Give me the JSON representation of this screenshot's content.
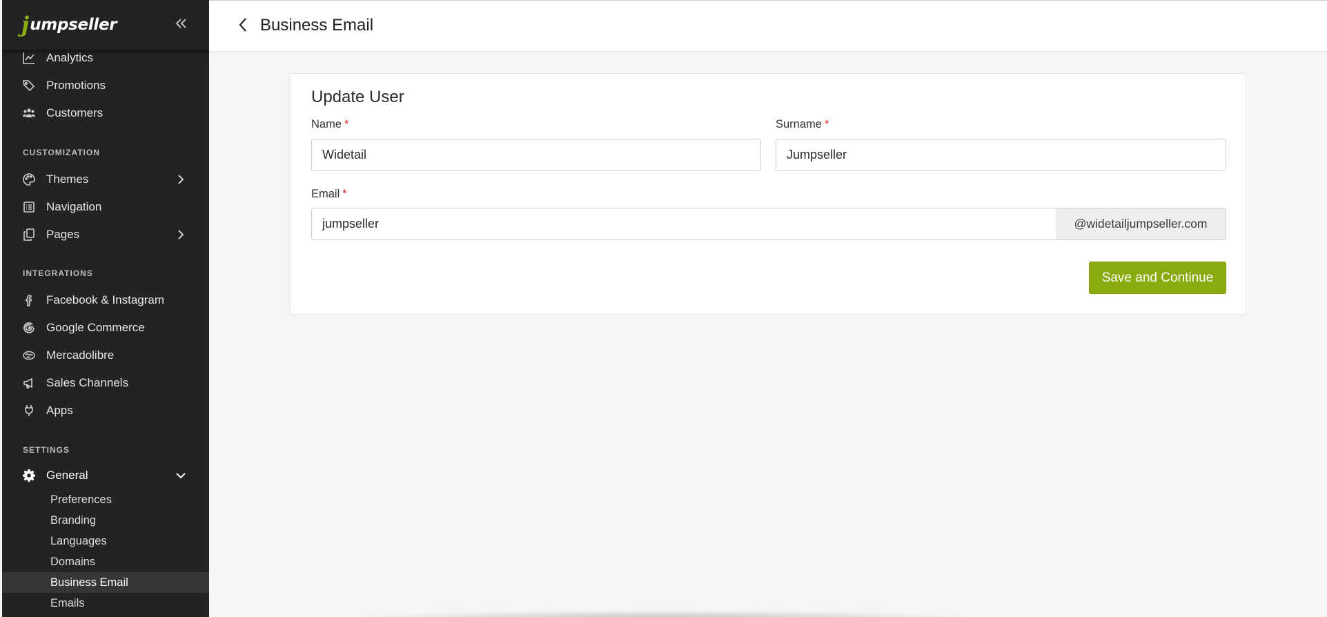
{
  "app": {
    "brand_j": "j",
    "brand_rest": "umpseller"
  },
  "sidebar": {
    "top_items": [
      {
        "label": "Analytics",
        "icon": "chart-line-icon"
      },
      {
        "label": "Promotions",
        "icon": "tags-icon"
      },
      {
        "label": "Customers",
        "icon": "users-icon"
      }
    ],
    "sections": {
      "customization": "CUSTOMIZATION",
      "integrations": "INTEGRATIONS",
      "settings": "SETTINGS"
    },
    "customization_items": [
      {
        "label": "Themes",
        "icon": "palette-icon",
        "has_submenu": true
      },
      {
        "label": "Navigation",
        "icon": "list-icon",
        "has_submenu": false
      },
      {
        "label": "Pages",
        "icon": "pages-icon",
        "has_submenu": true
      }
    ],
    "integration_items": [
      {
        "label": "Facebook & Instagram",
        "icon": "facebook-icon"
      },
      {
        "label": "Google Commerce",
        "icon": "google-icon"
      },
      {
        "label": "Mercadolibre",
        "icon": "handshake-icon"
      },
      {
        "label": "Sales Channels",
        "icon": "megaphone-icon"
      },
      {
        "label": "Apps",
        "icon": "plug-icon"
      }
    ],
    "general": {
      "label": "General",
      "icon": "gear-icon",
      "expanded": true
    },
    "general_subitems": [
      {
        "label": "Preferences",
        "active": false
      },
      {
        "label": "Branding",
        "active": false
      },
      {
        "label": "Languages",
        "active": false
      },
      {
        "label": "Domains",
        "active": false
      },
      {
        "label": "Business Email",
        "active": true
      },
      {
        "label": "Emails",
        "active": false
      }
    ]
  },
  "header": {
    "title": "Business Email"
  },
  "form": {
    "title": "Update User",
    "required_mark": "*",
    "name": {
      "label": "Name",
      "value": "Widetail"
    },
    "surname": {
      "label": "Surname",
      "value": "Jumpseller"
    },
    "email": {
      "label": "Email",
      "value": "jumpseller",
      "domain_suffix": "@widetailjumpseller.com"
    },
    "submit_label": "Save and Continue"
  },
  "colors": {
    "sidebar_bg": "#232323",
    "brand_green": "#8db011",
    "button_green": "#8aab0f",
    "required_red": "#e0242a"
  }
}
